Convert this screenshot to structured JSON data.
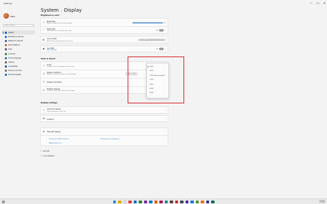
{
  "window": {
    "app_title": "Settings",
    "controls": [
      "—",
      "☐",
      "✕"
    ]
  },
  "user": {
    "name": "Mike"
  },
  "search": {
    "placeholder": "Find a setting"
  },
  "sidebar": {
    "items": [
      {
        "label": "System",
        "color": "#0067c0"
      },
      {
        "label": "Bluetooth & devices",
        "color": "#1a73e8"
      },
      {
        "label": "Network & internet",
        "color": "#4a6fa5"
      },
      {
        "label": "Personalization",
        "color": "#c2703d"
      },
      {
        "label": "Apps",
        "color": "#5b5b8f"
      },
      {
        "label": "Accounts",
        "color": "#2e8b57"
      },
      {
        "label": "Time & language",
        "color": "#2b79c2"
      },
      {
        "label": "Gaming",
        "color": "#6b6b6b"
      },
      {
        "label": "Accessibility",
        "color": "#1f5faa"
      },
      {
        "label": "Privacy & security",
        "color": "#777777"
      },
      {
        "label": "Windows Update",
        "color": "#1976d2"
      }
    ]
  },
  "breadcrumb": {
    "parent": "System",
    "separator": "›",
    "current": "Display"
  },
  "sections": {
    "brightness": "Brightness & color",
    "scale": "Scale & layout",
    "related": "Related settings"
  },
  "rows": {
    "brightness": {
      "title": "Brightness",
      "sub": "Adjust the brightness of the built-in display",
      "level": 0.94
    },
    "night": {
      "title": "Night light",
      "sub": "Use warmer colors to help block blue light",
      "state": "Off"
    },
    "profile": {
      "title": "Color profile",
      "sub": "Adjust the way colors appear on your screen",
      "value": "Surface Laptop Studio Profile (Default)"
    },
    "hdr": {
      "title": "Use HDR",
      "sub": "More about HDR",
      "state": "Off"
    },
    "scale": {
      "title": "Scale",
      "sub": "Change the size of text, apps, and other items"
    },
    "resolution": {
      "title": "Display resolution",
      "sub": "Adjust the resolution to fit your connected display",
      "value": "2400 × 1600"
    },
    "orientation": {
      "title": "Display orientation"
    },
    "multiple": {
      "title": "Multiple displays",
      "sub": "Choose the presentation mode for your displays"
    },
    "advanced": {
      "title": "Advanced display",
      "sub": "Display information, refresh rate"
    },
    "graphics": {
      "title": "Graphics"
    },
    "help": {
      "title": "Help with Display"
    }
  },
  "help_links": [
    "Setting up multiple monitors",
    "Changing screen brightness",
    "Adjusting font size"
  ],
  "scale_options": [
    "100%",
    "125%",
    "150% (Recommended)",
    "175%",
    "200%",
    "225%",
    "250%"
  ],
  "scale_selected_index": 0,
  "bottom_links": {
    "get_help": "Get help",
    "feedback": "Give feedback"
  },
  "taskbar": {
    "icons": [
      "#1e88e5",
      "#e0a800",
      "#ffffff",
      "#e53935",
      "#1565c0",
      "#2e7d32",
      "#6a1b9a",
      "#0277bd",
      "#e65100",
      "#ad1457",
      "#00838f",
      "#5d4037",
      "#c62828",
      "#37474f",
      "#4527a0",
      "#1976d2",
      "#558b2f",
      "#ef6c00",
      "#283593",
      "#00695c"
    ],
    "time": "12:00 PM",
    "date": "1/1/2022"
  },
  "colors": {
    "accent": "#0067c0",
    "highlight_box": "#d9232a"
  }
}
